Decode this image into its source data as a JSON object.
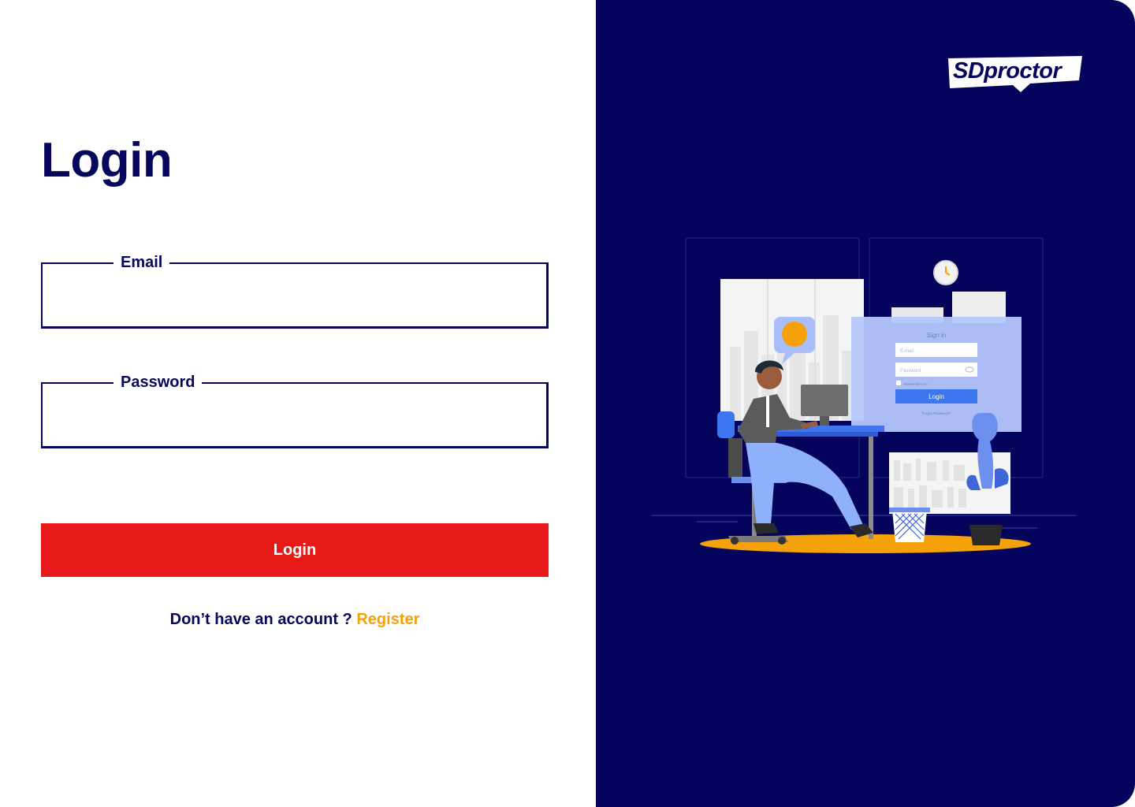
{
  "login_form": {
    "title": "Login",
    "email": {
      "label": "Email",
      "value": "",
      "placeholder": ""
    },
    "password": {
      "label": "Password",
      "value": "",
      "placeholder": ""
    },
    "submit_label": "Login",
    "register_prompt": "Don’t have an account ?",
    "register_link": "Register"
  },
  "brand": {
    "logo_text": "SDproctor"
  },
  "illustration": {
    "signin_title": "Sign in",
    "email_placeholder": "E-mail",
    "password_placeholder": "Password",
    "remember_label": "Remember me",
    "button_label": "Login",
    "forgot_label": "Forgot Password?"
  },
  "colors": {
    "primary": "#06065c",
    "panel": "#04045c",
    "button": "#e81919",
    "link": "#f5a20a"
  }
}
